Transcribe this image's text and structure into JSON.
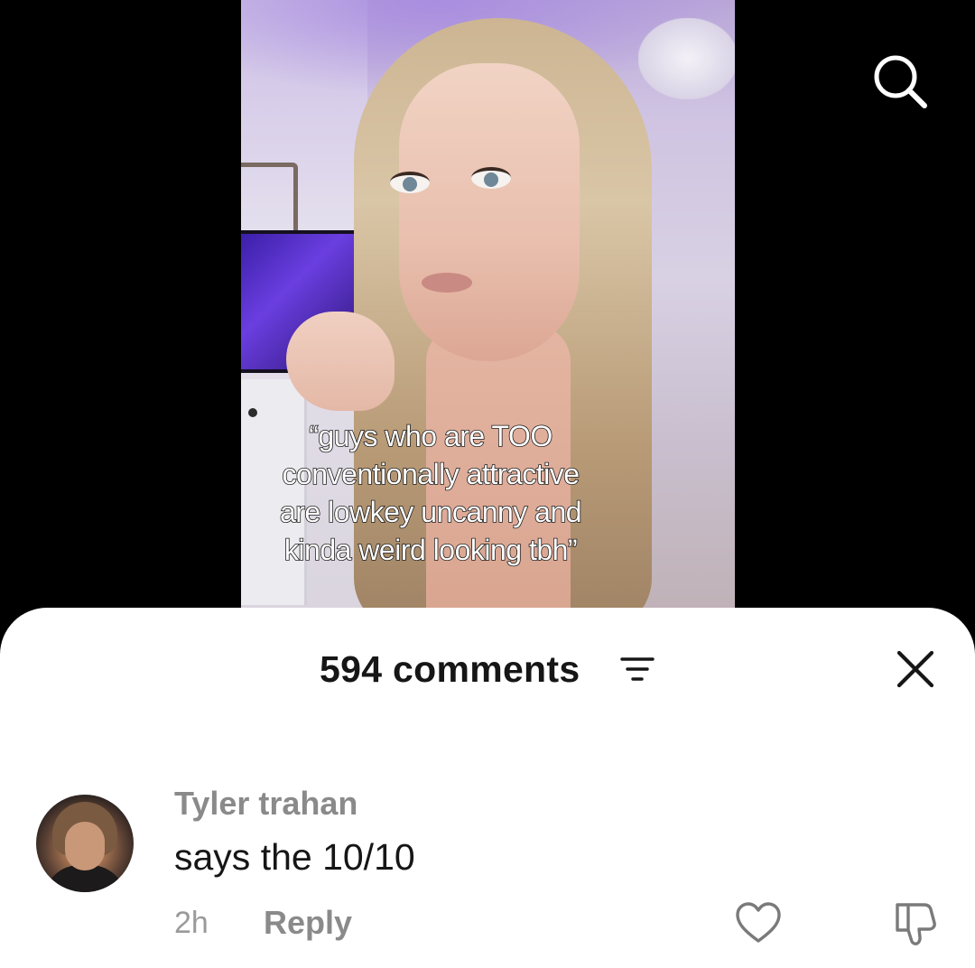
{
  "video": {
    "caption_lines": [
      "“guys who are TOO",
      "conventionally attractive",
      "are lowkey uncanny and",
      "kinda weird looking tbh”"
    ]
  },
  "header": {
    "search_icon": "search-icon"
  },
  "comments_sheet": {
    "title": "594 comments",
    "sort_icon": "filter-lines-icon",
    "close_icon": "close-icon",
    "comments": [
      {
        "author": "Tyler trahan",
        "text": "says the 10/10",
        "time": "2h",
        "reply_label": "Reply",
        "like_icon": "heart-outline-icon",
        "dislike_icon": "thumbs-down-outline-icon"
      }
    ]
  },
  "colors": {
    "background": "#000000",
    "sheet": "#ffffff",
    "primary_text": "#161616",
    "secondary_text": "#8a8a8a"
  }
}
